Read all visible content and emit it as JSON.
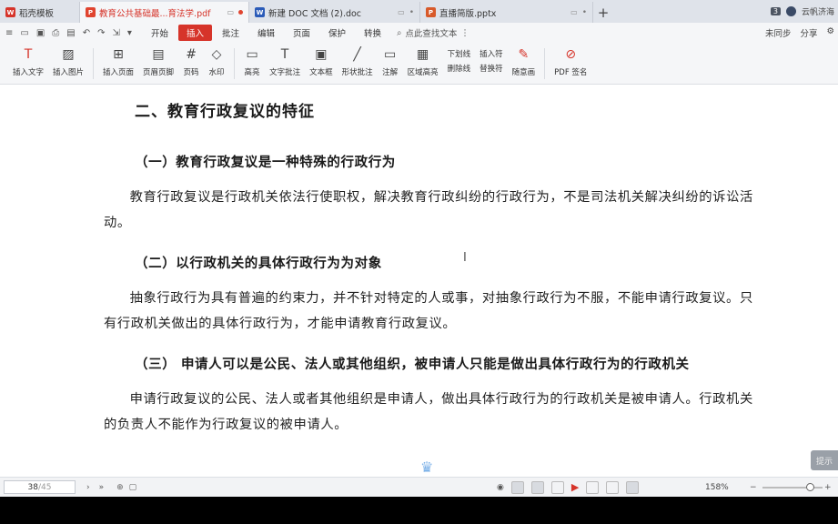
{
  "tabs": [
    {
      "label": "稻壳模板",
      "icon": "wps-icon",
      "color": "#d6342a",
      "active": false
    },
    {
      "label": "教育公共基础最...育法学.pdf",
      "icon": "pdf-icon",
      "color": "#e0442f",
      "active": true
    },
    {
      "label": "新建 DOC 文档 (2).doc",
      "icon": "word-icon",
      "color": "#2b5bb8",
      "active": false
    },
    {
      "label": "直播简版.pptx",
      "icon": "ppt-icon",
      "color": "#d85a2a",
      "active": false
    }
  ],
  "tabbar": {
    "add": "+",
    "count": "3",
    "user": "云帆济海"
  },
  "menu": {
    "items": [
      "开始",
      "插入",
      "批注",
      "编辑",
      "页面",
      "保护",
      "转换"
    ],
    "active": "插入",
    "search": "点此查找文本",
    "right": [
      "未同步",
      "分享"
    ]
  },
  "ribbon": {
    "insert_text": "插入文字",
    "insert_image": "插入图片",
    "insert_page": "插入页面",
    "header_footer": "页眉页脚",
    "page_number": "页码",
    "watermark": "水印",
    "highlight": "高亮",
    "text_note": "文字批注",
    "text_box": "文本框",
    "shape_note": "形状批注",
    "annotation": "注解",
    "area_highlight": "区域高亮",
    "underline": "下划线",
    "strikethrough": "删除线",
    "insert_symbol": "插入符",
    "replace_symbol": "替换符",
    "freehand": "随意画",
    "pdf_sign": "PDF 签名"
  },
  "document": {
    "heading": "二、教育行政复议的特征",
    "sections": [
      {
        "title": "（一）教育行政复议是一种特殊的行政行为",
        "text": "教育行政复议是行政机关依法行使职权，解决教育行政纠纷的行政行为，不是司法机关解决纠纷的诉讼活动。"
      },
      {
        "title": "（二）以行政机关的具体行政行为为对象",
        "text": "抽象行政行为具有普遍的约束力，并不针对特定的人或事，对抽象行政行为不服，不能申请行政复议。只有行政机关做出的具体行政行为，才能申请教育行政复议。"
      },
      {
        "title": "（三） 申请人可以是公民、法人或其他组织，被申请人只能是做出具体行政行为的行政机关",
        "text": "申请行政复议的公民、法人或者其他组织是申请人，做出具体行政行为的行政机关是被申请人。行政机关的负责人不能作为行政复议的被申请人。"
      }
    ],
    "side_button": "提示"
  },
  "status": {
    "current_page": "38",
    "total_pages": "/45",
    "zoom": "158%"
  }
}
